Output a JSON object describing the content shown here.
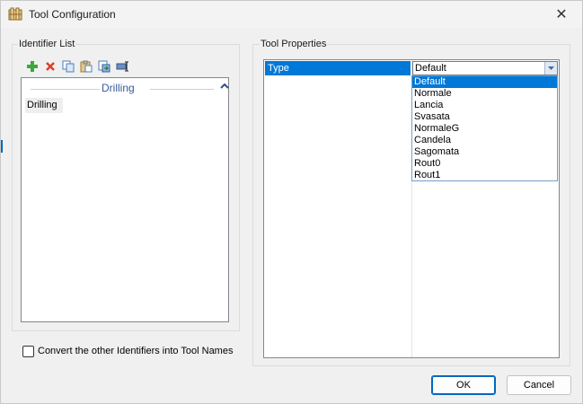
{
  "window": {
    "title": "Tool Configuration",
    "close_symbol": "✕"
  },
  "identifier_list": {
    "label": "Identifier List",
    "toolbar": [
      {
        "icon": "add-icon",
        "color": "#3aa83a"
      },
      {
        "icon": "delete-icon",
        "color": "#e03c2c"
      },
      {
        "icon": "copy-icon",
        "color": "#4a7fc1"
      },
      {
        "icon": "paste-icon",
        "color": "#c9a14a"
      },
      {
        "icon": "import-icon",
        "color": "#4a7fc1"
      },
      {
        "icon": "rename-icon",
        "color": "#4a6fa5"
      }
    ],
    "group_header": "Drilling",
    "items": [
      "Drilling"
    ]
  },
  "convert_checkbox": {
    "label": "Convert the other Identifiers into Tool Names",
    "checked": false
  },
  "tool_properties": {
    "label": "Tool Properties",
    "row": {
      "name": "Type",
      "value": "Default"
    },
    "dropdown_options": [
      "Default",
      "Normale",
      "Lancia",
      "Svasata",
      "NormaleG",
      "Candela",
      "Sagomata",
      "Rout0",
      "Rout1"
    ],
    "selected_option": "Default"
  },
  "buttons": {
    "ok": "OK",
    "cancel": "Cancel"
  },
  "colors": {
    "selection": "#0078d7",
    "group_header_text": "#3a5a9a",
    "default_button_border": "#0067c0"
  }
}
